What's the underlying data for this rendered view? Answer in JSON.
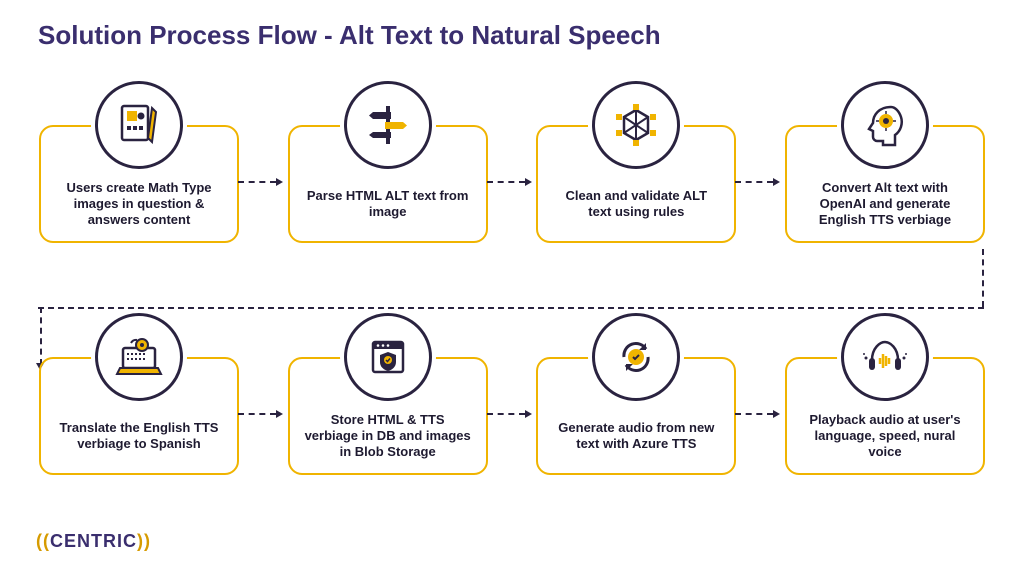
{
  "title": "Solution Process Flow - Alt Text to Natural Speech",
  "steps": [
    {
      "icon": "document-icon",
      "text": "Users create Math Type images in question & answers content"
    },
    {
      "icon": "signpost-icon",
      "text": "Parse HTML ALT text from image"
    },
    {
      "icon": "cube-icon",
      "text": "Clean and validate ALT text using rules"
    },
    {
      "icon": "ai-head-icon",
      "text": "Convert Alt text with OpenAI and generate English TTS verbiage"
    },
    {
      "icon": "translate-laptop-icon",
      "text": "Translate the English TTS verbiage to Spanish"
    },
    {
      "icon": "database-shield-icon",
      "text": "Store HTML & TTS verbiage in DB and images in Blob Storage"
    },
    {
      "icon": "refresh-audio-icon",
      "text": "Generate audio from new text with Azure TTS"
    },
    {
      "icon": "headphones-voice-icon",
      "text": "Playback audio at user's language, speed, nural voice"
    }
  ],
  "logo": {
    "brand": "CENTRIC"
  },
  "colors": {
    "accent_yellow": "#f0b400",
    "dark_navy": "#2a2340",
    "title_purple": "#3a2e6e"
  }
}
